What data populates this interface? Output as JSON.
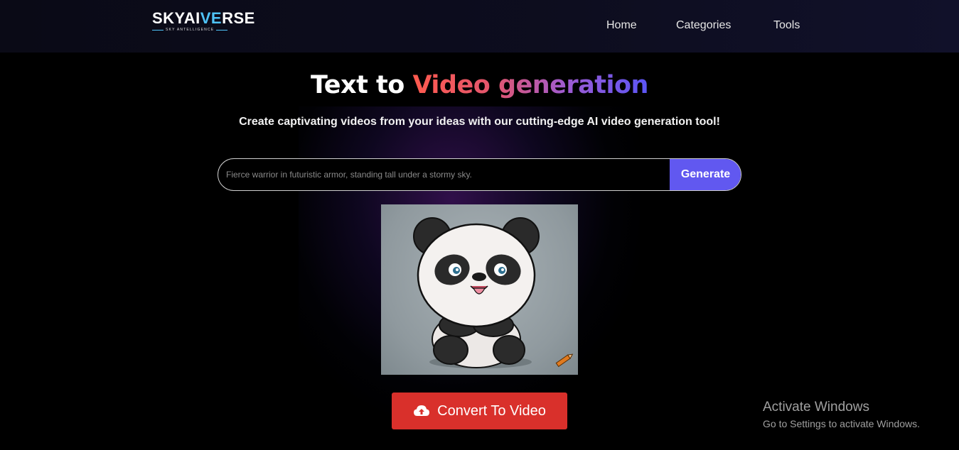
{
  "brand": {
    "logo_text_left": "SKYAI",
    "logo_text_accent": "VE",
    "logo_text_right": "RSE",
    "logo_tagline": "SKY ANTELLIGENCE",
    "accent_color": "#4fc3f7"
  },
  "nav": {
    "items": [
      {
        "label": "Home"
      },
      {
        "label": "Categories"
      },
      {
        "label": "Tools"
      }
    ]
  },
  "hero": {
    "title_plain": "Text to ",
    "title_gradient": "Video generation",
    "subtitle": "Create captivating videos from your ideas with our cutting-edge AI video generation tool!",
    "gradient_colors": [
      "#ff5a4e",
      "#e2566f",
      "#9f5bd1",
      "#5b55f5"
    ]
  },
  "prompt": {
    "placeholder": "Fierce warrior in futuristic armor, standing tall under a stormy sky.",
    "value": "",
    "generate_label": "Generate",
    "generate_color": "#6158f0"
  },
  "preview": {
    "subject": "cartoon panda",
    "corner_icon": "pencil-icon"
  },
  "convert": {
    "label": "Convert To Video",
    "icon": "cloud-upload-icon",
    "color": "#d9302b"
  },
  "os_watermark": {
    "line1": "Activate Windows",
    "line2": "Go to Settings to activate Windows."
  }
}
